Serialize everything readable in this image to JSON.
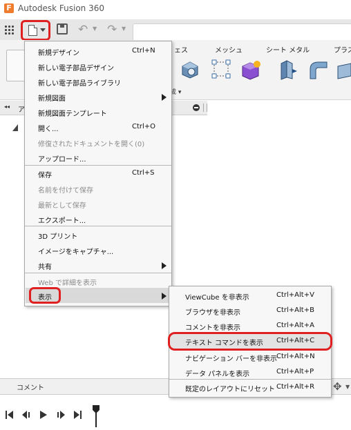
{
  "window": {
    "title": "Autodesk Fusion 360",
    "logo_letter": "F"
  },
  "ribbon": {
    "labels": {
      "solid_partial": "ェス",
      "mesh": "メッシュ",
      "sheet_metal": "シート メタル",
      "plastic_partial": "プラス"
    },
    "create_partial": "成 ▾"
  },
  "browser": {
    "collapse": "◂◂",
    "partial": "ア"
  },
  "comment": {
    "label": "コメント"
  },
  "file_menu": {
    "items": [
      {
        "label": "新規デザイン",
        "shortcut": "Ctrl+N"
      },
      {
        "label": "新しい電子部品デザイン"
      },
      {
        "label": "新しい電子部品ライブラリ"
      },
      {
        "label": "新規図面"
      },
      {
        "label": "新規図面テンプレート"
      },
      {
        "label": "開く...",
        "shortcut": "Ctrl+O"
      },
      {
        "label": "修復されたドキュメントを開く(0)"
      },
      {
        "label": "アップロード..."
      },
      {
        "label": "保存",
        "shortcut": "Ctrl+S"
      },
      {
        "label": "名前を付けて保存"
      },
      {
        "label": "最新として保存"
      },
      {
        "label": "エクスポート..."
      },
      {
        "label": "3D プリント"
      },
      {
        "label": "イメージをキャプチャ..."
      },
      {
        "label": "共有"
      },
      {
        "label": "Web で詳細を表示"
      },
      {
        "label": "表示"
      }
    ]
  },
  "submenu": {
    "items": [
      {
        "label": "ViewCube を非表示",
        "shortcut": "Ctrl+Alt+V"
      },
      {
        "label": "ブラウザを非表示",
        "shortcut": "Ctrl+Alt+B"
      },
      {
        "label": "コメントを非表示",
        "shortcut": "Ctrl+Alt+A"
      },
      {
        "label": "テキスト コマンドを表示",
        "shortcut": "Ctrl+Alt+C"
      },
      {
        "label": "ナビゲーション バーを非表示",
        "shortcut": "Ctrl+Alt+N"
      },
      {
        "label": "データ パネルを表示",
        "shortcut": "Ctrl+Alt+P"
      },
      {
        "label": "既定のレイアウトにリセット",
        "shortcut": "Ctrl+Alt+R"
      }
    ]
  },
  "colors": {
    "highlight_circle": "#e02020",
    "menu_bg": "#f7f7f7",
    "selected_bg": "#d9d9d9"
  }
}
